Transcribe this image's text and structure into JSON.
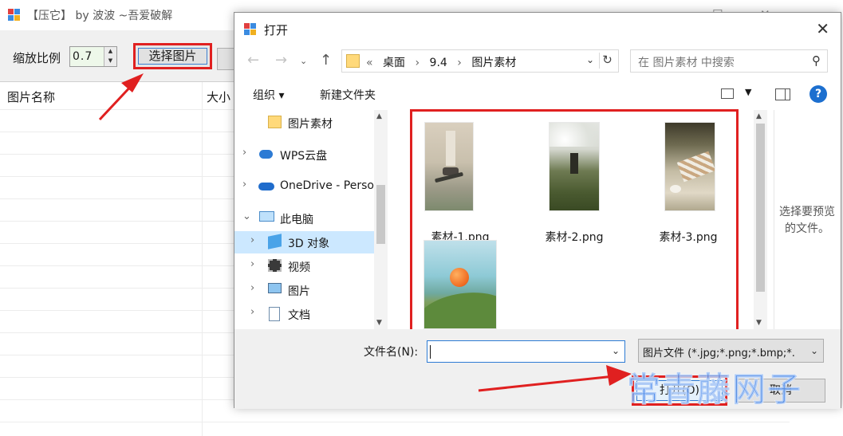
{
  "app": {
    "title": "【压它】 by 波波 ~吾爱破解",
    "minimize": "—",
    "maximize": "☐",
    "close": "✕",
    "scale_label": "缩放比例",
    "scale_value": "0.7",
    "select_image_label": "选择图片",
    "columns": {
      "name": "图片名称",
      "size": "大小"
    }
  },
  "dialog": {
    "title": "打开",
    "close": "✕",
    "path": {
      "prefix": "«",
      "segments": [
        "桌面",
        "9.4",
        "图片素材"
      ],
      "separator": "›"
    },
    "search_placeholder": "在 图片素材 中搜索",
    "organize_label": "组织 ▾",
    "new_folder_label": "新建文件夹",
    "help": "?",
    "nav_items": [
      {
        "label": "图片素材",
        "icon": "folder-icon",
        "chevron": ""
      },
      {
        "label": "WPS云盘",
        "icon": "cloud-icon",
        "chevron": "›"
      },
      {
        "label": "OneDrive - Perso",
        "icon": "onedrive-icon",
        "chevron": "›"
      },
      {
        "label": "此电脑",
        "icon": "computer-icon",
        "chevron": "⌄"
      },
      {
        "label": "3D 对象",
        "icon": "3d-objects-icon",
        "chevron": "›"
      },
      {
        "label": "视频",
        "icon": "video-icon",
        "chevron": "›"
      },
      {
        "label": "图片",
        "icon": "pictures-icon",
        "chevron": "›"
      },
      {
        "label": "文档",
        "icon": "documents-icon",
        "chevron": "›"
      }
    ],
    "files": [
      {
        "name": "素材-1.png"
      },
      {
        "name": "素材-2.png"
      },
      {
        "name": "素材-3.png"
      },
      {
        "name": ""
      }
    ],
    "preview_text": "选择要预览的文件。",
    "filename_label": "文件名(N):",
    "filename_value": "",
    "filter_text": "图片文件 (*.jpg;*.png;*.bmp;*.",
    "open_label": "打开(O)",
    "cancel_label": "取消"
  },
  "watermark": "常青藤网子",
  "colors": {
    "annotation_red": "#e02020",
    "selection_blue": "#cce8ff",
    "accent_blue": "#2d7bd4"
  }
}
